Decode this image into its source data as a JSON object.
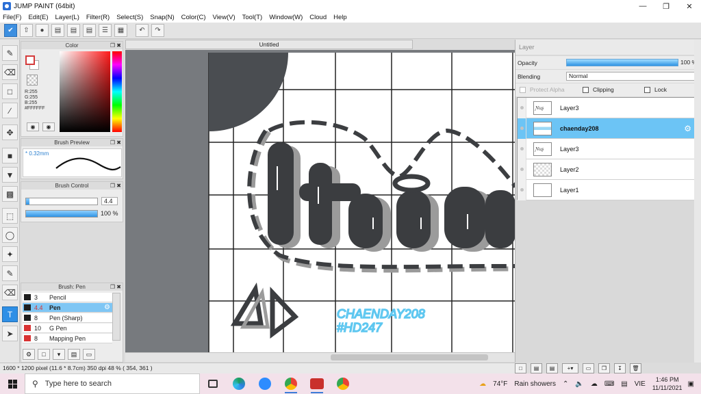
{
  "window": {
    "title": "JUMP PAINT (64bit)"
  },
  "menu": [
    "File(F)",
    "Edit(E)",
    "Layer(L)",
    "Filter(R)",
    "Select(S)",
    "Snap(N)",
    "Color(C)",
    "View(V)",
    "Tool(T)",
    "Window(W)",
    "Cloud",
    "Help"
  ],
  "panels": {
    "color": {
      "title": "Color",
      "r": "R:255",
      "g": "G:255",
      "b": "B:255",
      "hex": "#FFFFFF"
    },
    "brush_preview": {
      "title": "Brush Preview",
      "size": "0.32mm"
    },
    "brush_control": {
      "title": "Brush Control",
      "size_value": "4.4",
      "size_fraction": 0.05,
      "opacity_value": "100 %",
      "opacity_fraction": 1.0
    },
    "brush_list": {
      "title": "Brush: Pen",
      "items": [
        {
          "size": "3",
          "name": "Pencil",
          "color": "#1e1e1e"
        },
        {
          "size": "4.4",
          "name": "Pen",
          "color": "#1e1e1e",
          "selected": true
        },
        {
          "size": "8",
          "name": "Pen (Sharp)",
          "color": "#1e1e1e"
        },
        {
          "size": "10",
          "name": "G Pen",
          "color": "#d83232"
        },
        {
          "size": "8",
          "name": "Mapping Pen",
          "color": "#d83232"
        }
      ]
    }
  },
  "canvas": {
    "tab_title": "Untitled",
    "artwork_text_line1": "CHAENDAY208",
    "artwork_text_line2": "#HD247",
    "artwork_color": "#5ec7f0"
  },
  "layer_panel": {
    "title": "Layer",
    "opacity_label": "Opacity",
    "opacity_value": "100 %",
    "blending_label": "Blending",
    "blending_value": "Normal",
    "protect_alpha": "Protect Alpha",
    "clipping": "Clipping",
    "lock": "Lock",
    "layers": [
      {
        "name": "Layer3",
        "thumb": "art"
      },
      {
        "name": "chaenday208",
        "thumb": "strip",
        "selected": true
      },
      {
        "name": "Layer3",
        "thumb": "art"
      },
      {
        "name": "Layer2",
        "thumb": "trans"
      },
      {
        "name": "Layer1",
        "thumb": "white"
      }
    ]
  },
  "status": {
    "text": "1600 * 1200 pixel   (11.6 * 8.7cm)   350 dpi   48 %   ( 354, 361 )"
  },
  "taskbar": {
    "search_placeholder": "Type here to search",
    "weather_temp": "74°F",
    "weather_desc": "Rain showers",
    "lang": "VIE",
    "time": "1:46 PM",
    "date": "11/11/2021"
  }
}
